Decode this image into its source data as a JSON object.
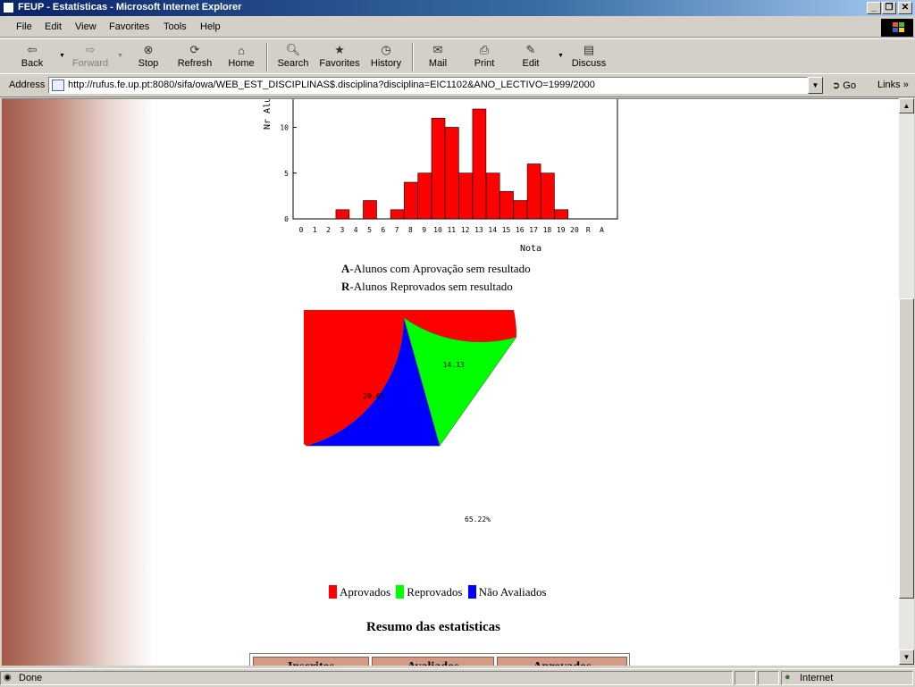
{
  "window": {
    "title": "FEUP - Estatísticas - Microsoft Internet Explorer",
    "btn_min": "_",
    "btn_max": "❐",
    "btn_close": "✕"
  },
  "menu": [
    "File",
    "Edit",
    "View",
    "Favorites",
    "Tools",
    "Help"
  ],
  "toolbar": {
    "back": "Back",
    "forward": "Forward",
    "stop": "Stop",
    "refresh": "Refresh",
    "home": "Home",
    "search": "Search",
    "favorites": "Favorites",
    "history": "History",
    "mail": "Mail",
    "print": "Print",
    "edit": "Edit",
    "discuss": "Discuss"
  },
  "address": {
    "label": "Address",
    "url": "http://rufus.fe.up.pt:8080/sifa/owa/WEB_EST_DISCIPLINAS$.disciplina?disciplina=EIC1102&ANO_LECTIVO=1999/2000",
    "go": "Go",
    "links": "Links"
  },
  "status": {
    "text": "Done",
    "zone": "Internet"
  },
  "page": {
    "note_a_bold": "A",
    "note_a_text": "-Alunos com Aprovação sem resultado",
    "note_r_bold": "R",
    "note_r_text": "-Alunos Reprovados sem resultado",
    "legend": [
      "Aprovados",
      "Reprovados",
      "Não Avaliados"
    ],
    "summary_title": "Resumo das estatisticas",
    "table_headers": [
      "Inscritos",
      "Avaliados",
      "Aprovados"
    ]
  },
  "chart_data": [
    {
      "type": "bar",
      "ylabel": "Nr Alu",
      "xlabel": "Nota",
      "categories": [
        "0",
        "1",
        "2",
        "3",
        "4",
        "5",
        "6",
        "7",
        "8",
        "9",
        "10",
        "11",
        "12",
        "13",
        "14",
        "15",
        "16",
        "17",
        "18",
        "19",
        "20",
        "R",
        "A"
      ],
      "values": [
        0,
        0,
        0,
        1,
        0,
        2,
        0,
        1,
        4,
        5,
        11,
        10,
        5,
        12,
        5,
        3,
        2,
        6,
        5,
        1,
        0,
        0,
        0
      ],
      "yticks": [
        0,
        5,
        10
      ],
      "color": "#ff0000"
    },
    {
      "type": "pie",
      "slices": [
        {
          "name": "Aprovados",
          "value": 65.22,
          "label": "65.22%",
          "color": "#ff0000"
        },
        {
          "name": "Reprovados",
          "value": 14.13,
          "label": "14.13",
          "color": "#00ff00"
        },
        {
          "name": "Não Avaliados",
          "value": 20.65,
          "label": "20.65",
          "color": "#0000ff"
        }
      ]
    }
  ]
}
